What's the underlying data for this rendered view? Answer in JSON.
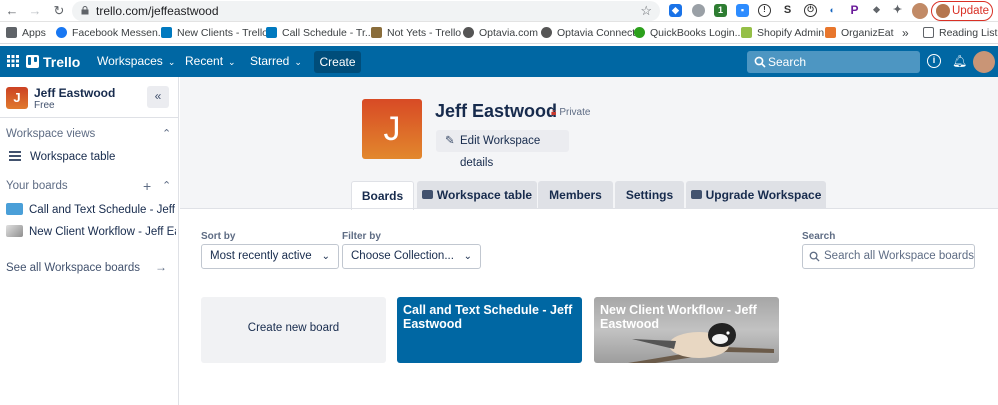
{
  "browser": {
    "url": "trello.com/jeffeastwood",
    "update_label": "Update",
    "bookmarks": [
      {
        "label": "Apps",
        "color": "#5f6368"
      },
      {
        "label": "Facebook Messen...",
        "color": "#1877f2"
      },
      {
        "label": "New Clients - Trello",
        "color": "#0079bf"
      },
      {
        "label": "Call Schedule - Tr...",
        "color": "#0079bf"
      },
      {
        "label": "Not Yets - Trello",
        "color": "#8a6d3b"
      },
      {
        "label": "Optavia.com",
        "color": "#555555"
      },
      {
        "label": "Optavia Connect",
        "color": "#555555"
      },
      {
        "label": "QuickBooks Login...",
        "color": "#2ca01c"
      },
      {
        "label": "Shopify Admin",
        "color": "#95bf47"
      },
      {
        "label": "OrganizEat",
        "color": "#e8762c"
      },
      {
        "label": "»",
        "color": ""
      },
      {
        "label": "Reading List",
        "color": "#5f6368"
      }
    ],
    "icons": [
      "back-icon",
      "forward-icon",
      "reload-icon",
      "lock-icon",
      "star-icon",
      "extensions-icon"
    ]
  },
  "header": {
    "logo": "Trello",
    "menus": [
      "Workspaces",
      "Recent",
      "Starred"
    ],
    "create_label": "Create",
    "search_placeholder": "Search",
    "brand_color": "#0067a3"
  },
  "sidebar": {
    "workspace_initial": "J",
    "workspace_name": "Jeff Eastwood",
    "workspace_plan": "Free",
    "views_title": "Workspace views",
    "views": [
      {
        "label": "Workspace table",
        "icon": "table-icon"
      }
    ],
    "boards_title": "Your boards",
    "boards": [
      {
        "label": "Call and Text Schedule - Jeff ...",
        "color": "#4a9fd8"
      },
      {
        "label": "New Client Workflow - Jeff Ea...",
        "color": "#b8b8b8"
      }
    ],
    "see_all": "See all Workspace boards"
  },
  "main": {
    "avatar_initial": "J",
    "title": "Jeff Eastwood",
    "visibility": "Private",
    "edit_label": "Edit Workspace details",
    "tabs": [
      {
        "label": "Boards",
        "active": true
      },
      {
        "label": "Workspace table",
        "icon": true
      },
      {
        "label": "Members"
      },
      {
        "label": "Settings"
      },
      {
        "label": "Upgrade Workspace",
        "icon": true
      }
    ],
    "sort_label": "Sort by",
    "sort_value": "Most recently active",
    "filter_label": "Filter by",
    "filter_value": "Choose Collection...",
    "search_label": "Search",
    "search_placeholder": "Search all Workspace boards",
    "create_board": "Create new board",
    "boards": [
      {
        "title": "Call and Text Schedule - Jeff Eastwood"
      },
      {
        "title": "New Client Workflow - Jeff Eastwood"
      }
    ]
  }
}
